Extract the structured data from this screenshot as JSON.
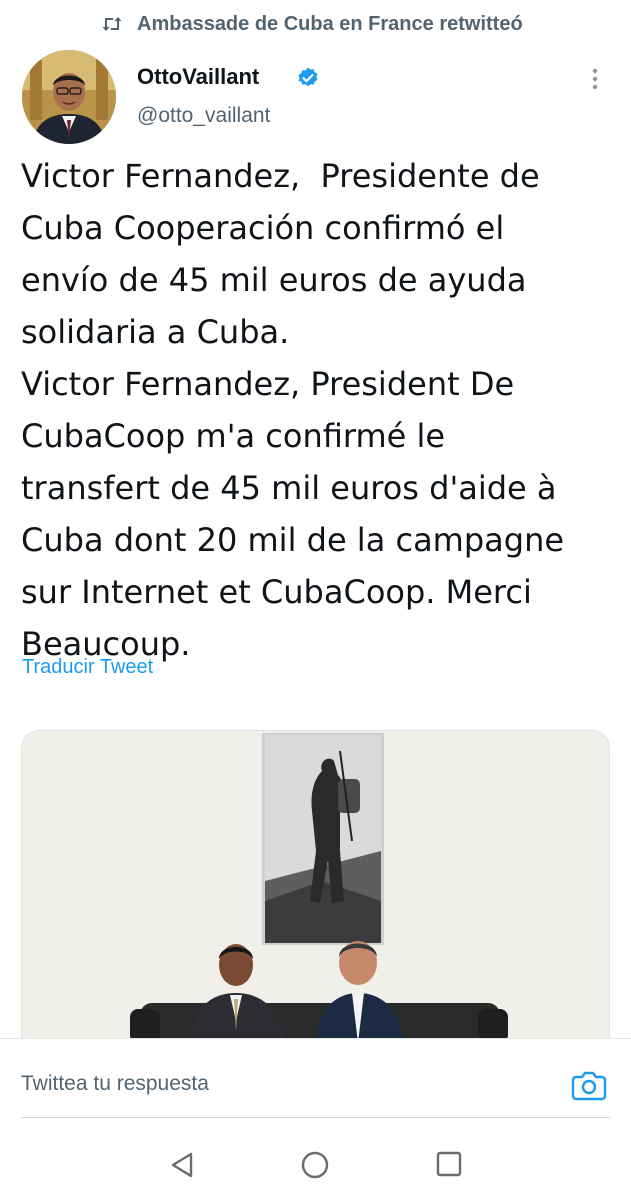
{
  "retweet_context": {
    "text": "Ambassade de Cuba en France retwitteó",
    "icon": "retweet-icon"
  },
  "author": {
    "display_name": "OttoVaillant",
    "handle": "@otto_vaillant",
    "verified_icon": "verified-badge-icon",
    "avatar": "avatar-photo"
  },
  "more_icon": "more-vertical-icon",
  "tweet": {
    "lines": [
      "Victor Fernandez,  Presidente de",
      "Cuba Cooperación confirmó el",
      "envío de 45 mil euros de ayuda",
      "solidaria a Cuba.",
      "Victor Fernandez, President De",
      "CubaCoop m'a confirmé le",
      "transfert de 45 mil euros d'aide à",
      "Cuba dont 20 mil de la campagne",
      "sur Internet et CubaCoop. Merci",
      "Beaucoup."
    ],
    "translate_label": "Traducir Tweet"
  },
  "media": {
    "type": "photo"
  },
  "reply": {
    "placeholder": "Twittea tu respuesta",
    "camera_icon": "camera-icon"
  },
  "nav": {
    "back_icon": "back-triangle-icon",
    "home_icon": "home-circle-icon",
    "recent_icon": "recent-apps-icon"
  },
  "colors": {
    "link": "#1d9bf0",
    "secondary_text": "#536471",
    "primary_text": "#0f1419",
    "verified": "#1d9bf0"
  }
}
